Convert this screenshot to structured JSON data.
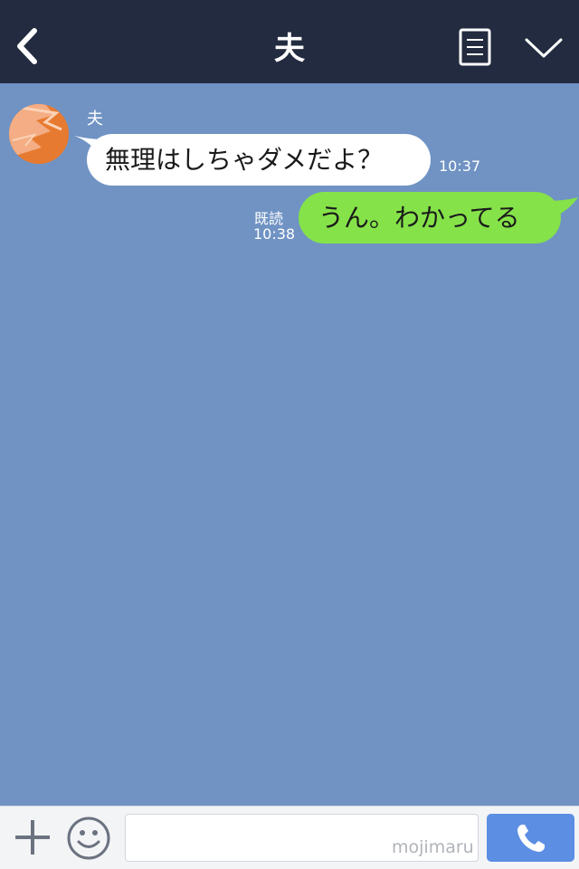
{
  "header": {
    "title": "夫",
    "back_icon": "chevron-left-icon",
    "memo_icon": "note-icon",
    "menu_icon": "chevron-down-icon"
  },
  "messages": [
    {
      "direction": "in",
      "sender": "夫",
      "text": "無理はしちゃダメだよ？",
      "time": "10:37"
    },
    {
      "direction": "out",
      "read_label": "既読",
      "text": "うん。わかってる",
      "time": "10:38"
    }
  ],
  "input_bar": {
    "plus_icon": "plus-icon",
    "emoji_icon": "smiley-icon",
    "input_value": "",
    "watermark": "mojimaru",
    "call_icon": "phone-icon"
  },
  "colors": {
    "header_bg": "#222b3f",
    "chat_bg": "#7093c4",
    "incoming_bubble": "#ffffff",
    "outgoing_bubble": "#85e249",
    "call_button": "#5c8ee3"
  }
}
